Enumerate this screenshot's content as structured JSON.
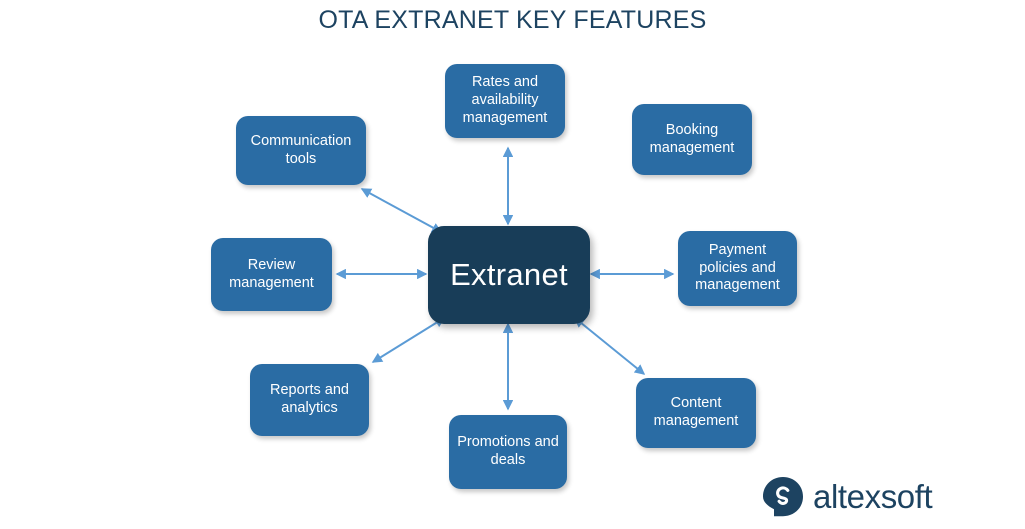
{
  "page": {
    "title": "OTA EXTRANET KEY FEATURES",
    "background_color": "#ffffff",
    "title_color": "#1d4361"
  },
  "diagram": {
    "type": "hub-and-spoke",
    "center": {
      "id": "extranet",
      "label": "Extranet",
      "color": "#183d58",
      "text_color": "#ffffff"
    },
    "node_color": "#2a6ca4",
    "arrow_color": "#5b9bd5",
    "nodes": [
      {
        "id": "rates-and-availability-management",
        "label": "Rates and availability management",
        "connected": true,
        "direction": "vertical-up"
      },
      {
        "id": "booking-management",
        "label": "Booking management",
        "connected": false,
        "direction": "none"
      },
      {
        "id": "payment-policies-and-management",
        "label": "Payment policies and management",
        "connected": true,
        "direction": "horizontal-right"
      },
      {
        "id": "content-management",
        "label": "Content management",
        "connected": true,
        "direction": "diagonal-down-right"
      },
      {
        "id": "promotions-and-deals",
        "label": "Promotions and deals",
        "connected": true,
        "direction": "vertical-down"
      },
      {
        "id": "reports-and-analytics",
        "label": "Reports and analytics",
        "connected": true,
        "direction": "diagonal-down-left"
      },
      {
        "id": "review-management",
        "label": "Review management",
        "connected": true,
        "direction": "horizontal-left"
      },
      {
        "id": "communication-tools",
        "label": "Communication tools",
        "connected": true,
        "direction": "diagonal-up-left"
      }
    ]
  },
  "logo": {
    "brand": "altexsoft",
    "mark_color": "#1d4361",
    "text_color": "#1d4361"
  }
}
